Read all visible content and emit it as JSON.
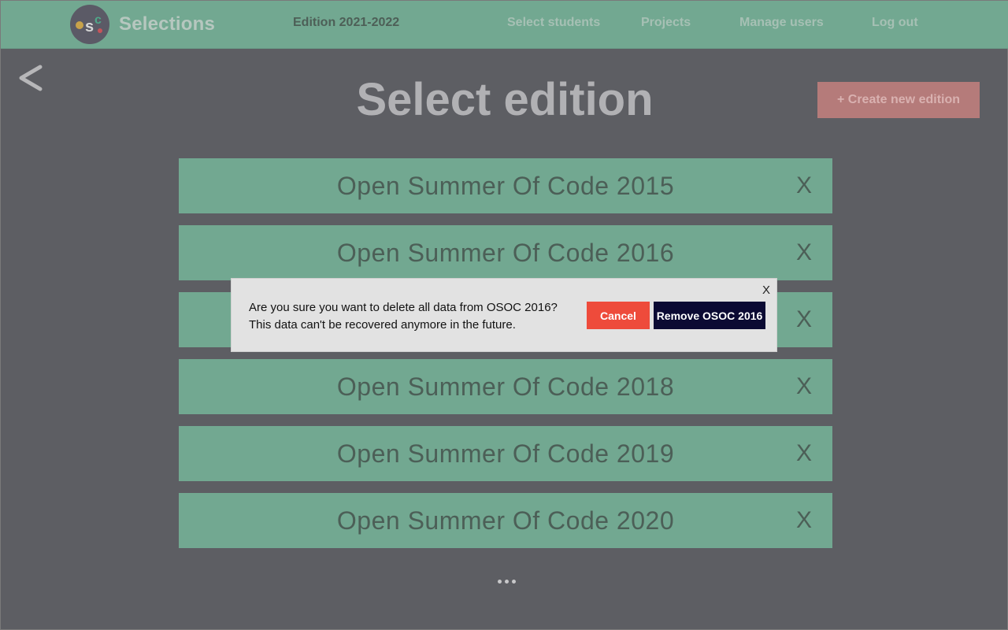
{
  "header": {
    "brand": "Selections",
    "edition": "Edition 2021-2022",
    "nav": [
      "Select students",
      "Projects",
      "Manage users",
      "Log out"
    ]
  },
  "page": {
    "title": "Select edition",
    "create_button": "+ Create new edition",
    "back_icon": "chevron-left-icon",
    "more_icon": "ellipsis-icon"
  },
  "editions": [
    {
      "label": "Open Summer Of Code 2015",
      "delete": "X"
    },
    {
      "label": "Open Summer Of Code 2016",
      "delete": "X"
    },
    {
      "label": "",
      "delete": "X"
    },
    {
      "label": "Open Summer Of Code 2018",
      "delete": "X"
    },
    {
      "label": "Open Summer Of Code 2019",
      "delete": "X"
    },
    {
      "label": "Open Summer Of Code 2020",
      "delete": "X"
    }
  ],
  "modal": {
    "close": "X",
    "line1": "Are you sure you want to delete all data from OSOC 2016?",
    "line2": "This data can't be recovered anymore in the future.",
    "cancel": "Cancel",
    "confirm": "Remove OSOC 2016"
  },
  "colors": {
    "navbar": "#72a891",
    "background": "#5d5e63",
    "create_button": "#b57b7a",
    "cancel": "#ee4b3b",
    "confirm": "#0b0a33"
  }
}
